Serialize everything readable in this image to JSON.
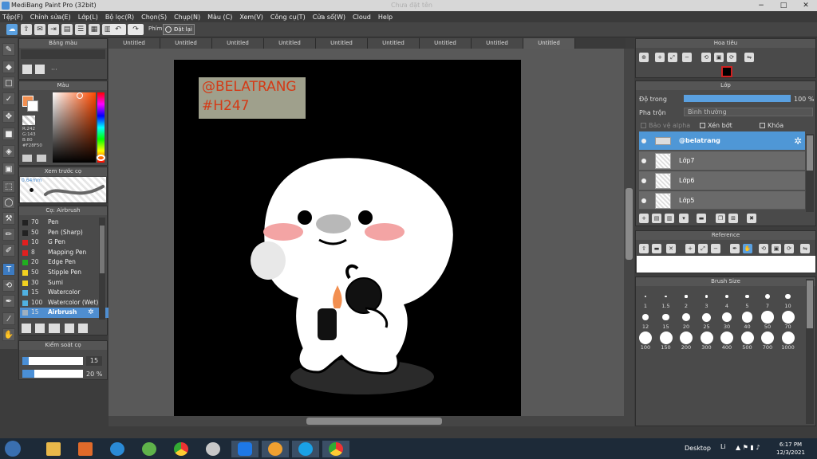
{
  "window": {
    "title": "MediBang Paint Pro (32bit)",
    "ghost_title": "Chưa đặt tên",
    "controls": [
      "−",
      "□",
      "✕"
    ]
  },
  "menu": [
    "Tệp(F)",
    "Chỉnh sửa(E)",
    "Lớp(L)",
    "Bộ lọc(R)",
    "Chọn(S)",
    "Chụp(N)",
    "Màu (C)",
    "Xem(V)",
    "Công cụ(T)",
    "Cửa sổ(W)",
    "Cloud",
    "Help"
  ],
  "toolbar": {
    "undo_icon": "↶",
    "redo_icon": "↷",
    "phim_label": "Phím",
    "dat_lai_label": "Đặt lại"
  },
  "tabs": [
    "Untitled",
    "Untitled",
    "Untitled",
    "Untitled",
    "Untitled",
    "Untitled",
    "Untitled",
    "Untitled",
    "Untitled"
  ],
  "left": {
    "bang_mau": {
      "title": "Bảng màu",
      "more": "···"
    },
    "mau": {
      "title": "Màu",
      "r": "R:242",
      "g": "G:143",
      "b": "B:80",
      "hex": "#F28F50",
      "current_color": "#F28F50"
    },
    "preview": {
      "title": "Xem trước cọ",
      "size": "0.64mm"
    },
    "brushes": {
      "title": "Cọ: Airbrush",
      "items": [
        {
          "size": "70",
          "name": "Pen",
          "color": "#222222"
        },
        {
          "size": "50",
          "name": "Pen (Sharp)",
          "color": "#222222"
        },
        {
          "size": "10",
          "name": "G Pen",
          "color": "#e02020"
        },
        {
          "size": "8",
          "name": "Mapping Pen",
          "color": "#e02020"
        },
        {
          "size": "20",
          "name": "Edge Pen",
          "color": "#20b020"
        },
        {
          "size": "50",
          "name": "Stipple Pen",
          "color": "#f0d020"
        },
        {
          "size": "30",
          "name": "Sumi",
          "color": "#f0d020"
        },
        {
          "size": "15",
          "name": "Watercolor",
          "color": "#50b0e0"
        },
        {
          "size": "100",
          "name": "Watercolor (Wet)",
          "color": "#50b0e0"
        },
        {
          "size": "15",
          "name": "Airbrush",
          "color": "#9fb0c0"
        }
      ]
    },
    "kiem_soat": {
      "title": "Kiểm soát cọ",
      "size_value": "15",
      "opacity_value": "20 %",
      "size_fraction": 0.1,
      "opacity_fraction": 0.2
    }
  },
  "canvas": {
    "watermark_line1": "@BELATRANG",
    "watermark_line2": "#H247"
  },
  "right": {
    "hoa_tieu": {
      "title": "Hoa tiêu"
    },
    "lop": {
      "title": "Lớp",
      "opacity_label": "Độ trong",
      "opacity_value": "100 %",
      "opacity_fraction": 1.0,
      "blend_label": "Pha trộn",
      "blend_value": "Bình thường",
      "protect_alpha": "Bảo vệ alpha",
      "clip": "Xén bớt",
      "lock": "Khóa",
      "layers": [
        "@belatrang",
        "Lớp7",
        "Lớp6",
        "Lớp5"
      ]
    },
    "reference": {
      "title": "Reference"
    },
    "brush_size": {
      "title": "Brush Size",
      "sizes": [
        "1",
        "1.5",
        "2",
        "3",
        "4",
        "5",
        "7",
        "10",
        "12",
        "15",
        "20",
        "25",
        "30",
        "40",
        "50",
        "70",
        "100",
        "150",
        "200",
        "300",
        "400",
        "500",
        "700",
        "1000"
      ]
    }
  },
  "taskbar": {
    "desktop_label": "Desktop",
    "lang": "Li",
    "time": "6:17 PM",
    "date": "12/3/2021"
  }
}
